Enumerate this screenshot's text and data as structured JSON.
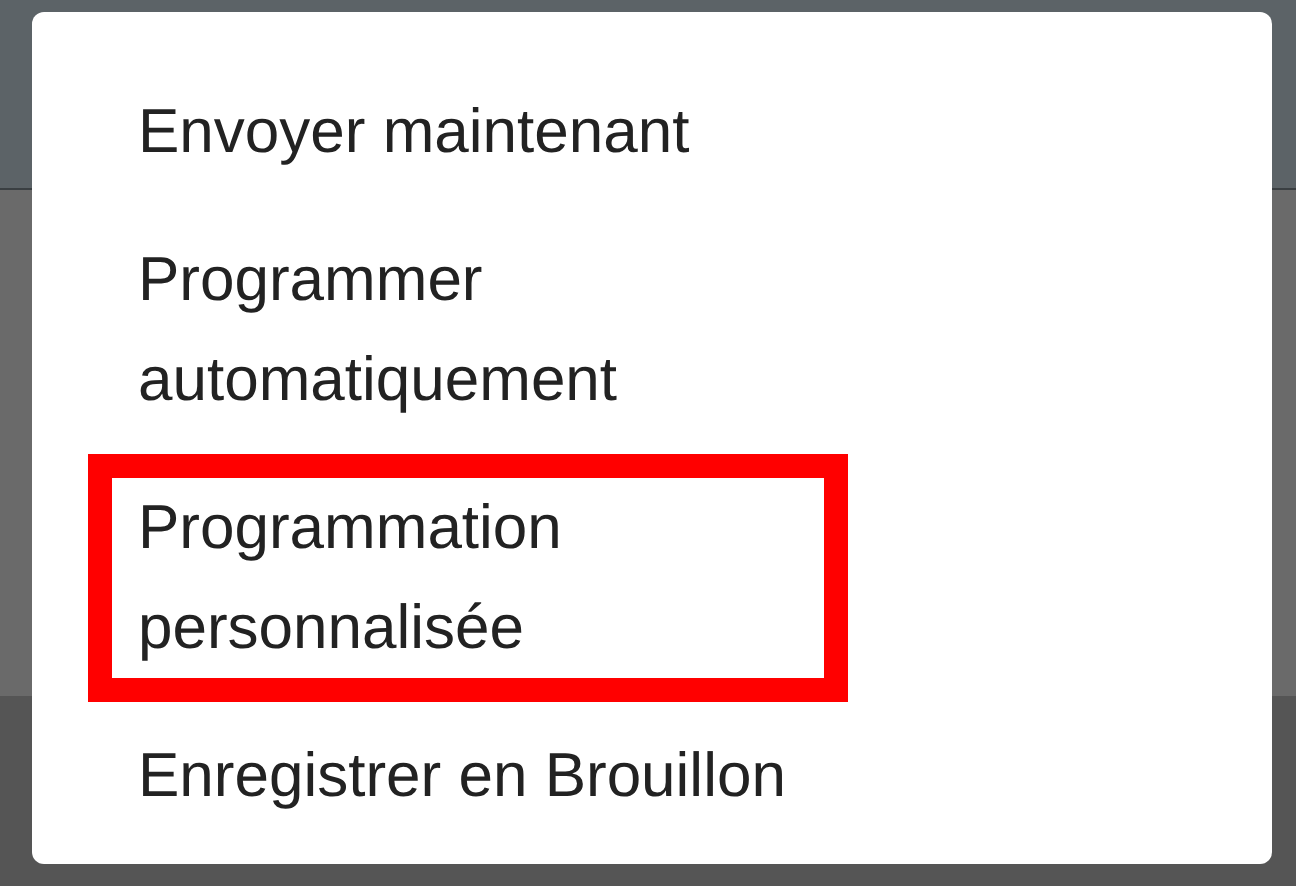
{
  "menu": {
    "items": [
      {
        "label": "Envoyer maintenant",
        "highlighted": false
      },
      {
        "label": "Programmer automatiquement",
        "highlighted": false
      },
      {
        "label": "Programmation personnalisée",
        "highlighted": true
      },
      {
        "label": "Enregistrer en Brouillon",
        "highlighted": false
      }
    ]
  }
}
